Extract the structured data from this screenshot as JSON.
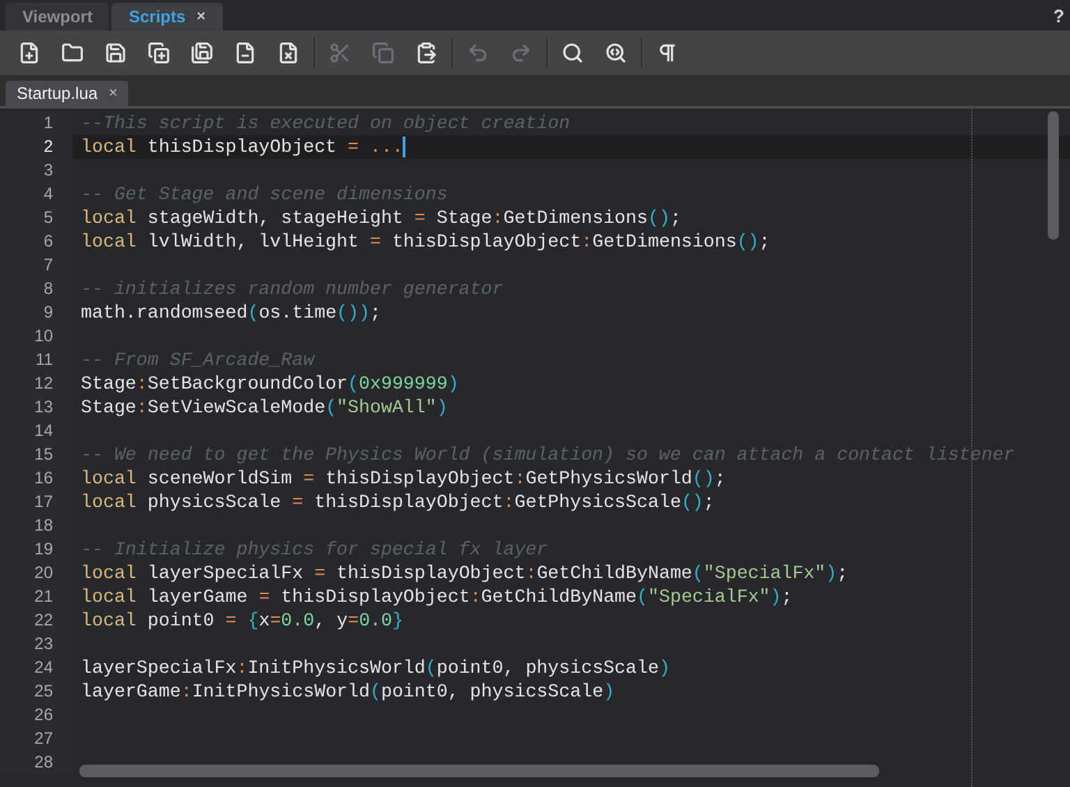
{
  "panel_tabs": [
    {
      "label": "Viewport",
      "selected": false
    },
    {
      "label": "Scripts",
      "selected": true,
      "close": "×"
    }
  ],
  "help": "?",
  "toolbar": [
    [
      {
        "kind": "new-file",
        "disabled": false
      },
      {
        "kind": "open",
        "disabled": false
      },
      {
        "kind": "save",
        "disabled": false
      },
      {
        "kind": "save-new",
        "disabled": false
      },
      {
        "kind": "save-all",
        "disabled": false
      },
      {
        "kind": "close-file",
        "disabled": false
      },
      {
        "kind": "close-all",
        "disabled": false
      }
    ],
    [
      {
        "kind": "cut",
        "disabled": true
      },
      {
        "kind": "copy",
        "disabled": true
      },
      {
        "kind": "paste",
        "disabled": false
      }
    ],
    [
      {
        "kind": "undo",
        "disabled": true
      },
      {
        "kind": "redo",
        "disabled": true
      }
    ],
    [
      {
        "kind": "find",
        "disabled": false
      },
      {
        "kind": "replace",
        "disabled": false
      }
    ],
    [
      {
        "kind": "whitespace",
        "disabled": false
      }
    ]
  ],
  "document_tabs": [
    {
      "label": "Startup.lua",
      "selected": true,
      "close": "×"
    }
  ],
  "lines": [
    {
      "number": "1",
      "current": false,
      "tokens": [
        {
          "kind": "comment",
          "text": "--This script is executed on object creation"
        }
      ]
    },
    {
      "number": "2",
      "current": true,
      "tokens": [
        {
          "kind": "keyword",
          "text": "local"
        },
        {
          "kind": "plain",
          "text": " thisDisplayObject "
        },
        {
          "kind": "op",
          "text": "= ..."
        }
      ]
    },
    {
      "number": "3",
      "current": false
    },
    {
      "number": "4",
      "current": false,
      "tokens": [
        {
          "kind": "comment",
          "text": "-- Get Stage and scene dimensions"
        }
      ]
    },
    {
      "number": "5",
      "current": false,
      "tokens": [
        {
          "kind": "keyword",
          "text": "local"
        },
        {
          "kind": "plain",
          "text": " stageWidth, stageHeight "
        },
        {
          "kind": "op",
          "text": "="
        },
        {
          "kind": "plain",
          "text": " Stage"
        },
        {
          "kind": "op",
          "text": ":"
        },
        {
          "kind": "plain",
          "text": "GetDimensions"
        },
        {
          "kind": "paren",
          "text": "()"
        },
        {
          "kind": "plain",
          "text": ";"
        }
      ]
    },
    {
      "number": "6",
      "current": false,
      "tokens": [
        {
          "kind": "keyword",
          "text": "local"
        },
        {
          "kind": "plain",
          "text": " lvlWidth, lvlHeight "
        },
        {
          "kind": "op",
          "text": "="
        },
        {
          "kind": "plain",
          "text": " thisDisplayObject"
        },
        {
          "kind": "op",
          "text": ":"
        },
        {
          "kind": "plain",
          "text": "GetDimensions"
        },
        {
          "kind": "paren",
          "text": "()"
        },
        {
          "kind": "plain",
          "text": ";"
        }
      ]
    },
    {
      "number": "7",
      "current": false
    },
    {
      "number": "8",
      "current": false,
      "tokens": [
        {
          "kind": "comment",
          "text": "-- initializes random number generator"
        }
      ]
    },
    {
      "number": "9",
      "current": false,
      "tokens": [
        {
          "kind": "plain",
          "text": "math.randomseed"
        },
        {
          "kind": "paren",
          "text": "("
        },
        {
          "kind": "plain",
          "text": "os.time"
        },
        {
          "kind": "paren",
          "text": "())"
        },
        {
          "kind": "plain",
          "text": ";"
        }
      ]
    },
    {
      "number": "10",
      "current": false
    },
    {
      "number": "11",
      "current": false,
      "tokens": [
        {
          "kind": "comment",
          "text": "-- From SF_Arcade_Raw"
        }
      ]
    },
    {
      "number": "12",
      "current": false,
      "tokens": [
        {
          "kind": "plain",
          "text": "Stage"
        },
        {
          "kind": "op",
          "text": ":"
        },
        {
          "kind": "plain",
          "text": "SetBackgroundColor"
        },
        {
          "kind": "paren",
          "text": "("
        },
        {
          "kind": "number",
          "text": "0x999999"
        },
        {
          "kind": "paren",
          "text": ")"
        }
      ]
    },
    {
      "number": "13",
      "current": false,
      "tokens": [
        {
          "kind": "plain",
          "text": "Stage"
        },
        {
          "kind": "op",
          "text": ":"
        },
        {
          "kind": "plain",
          "text": "SetViewScaleMode"
        },
        {
          "kind": "paren",
          "text": "("
        },
        {
          "kind": "string",
          "text": "\"ShowAll\""
        },
        {
          "kind": "paren",
          "text": ")"
        }
      ]
    },
    {
      "number": "14",
      "current": false
    },
    {
      "number": "15",
      "current": false,
      "tokens": [
        {
          "kind": "comment",
          "text": "-- We need to get the Physics World (simulation) so we can attach a contact listener"
        }
      ]
    },
    {
      "number": "16",
      "current": false,
      "tokens": [
        {
          "kind": "keyword",
          "text": "local"
        },
        {
          "kind": "plain",
          "text": " sceneWorldSim "
        },
        {
          "kind": "op",
          "text": "="
        },
        {
          "kind": "plain",
          "text": " thisDisplayObject"
        },
        {
          "kind": "op",
          "text": ":"
        },
        {
          "kind": "plain",
          "text": "GetPhysicsWorld"
        },
        {
          "kind": "paren",
          "text": "()"
        },
        {
          "kind": "plain",
          "text": ";"
        }
      ]
    },
    {
      "number": "17",
      "current": false,
      "tokens": [
        {
          "kind": "keyword",
          "text": "local"
        },
        {
          "kind": "plain",
          "text": " physicsScale "
        },
        {
          "kind": "op",
          "text": "="
        },
        {
          "kind": "plain",
          "text": " thisDisplayObject"
        },
        {
          "kind": "op",
          "text": ":"
        },
        {
          "kind": "plain",
          "text": "GetPhysicsScale"
        },
        {
          "kind": "paren",
          "text": "()"
        },
        {
          "kind": "plain",
          "text": ";"
        }
      ]
    },
    {
      "number": "18",
      "current": false
    },
    {
      "number": "19",
      "current": false,
      "tokens": [
        {
          "kind": "comment",
          "text": "-- Initialize physics for special fx layer"
        }
      ]
    },
    {
      "number": "20",
      "current": false,
      "tokens": [
        {
          "kind": "keyword",
          "text": "local"
        },
        {
          "kind": "plain",
          "text": " layerSpecialFx "
        },
        {
          "kind": "op",
          "text": "="
        },
        {
          "kind": "plain",
          "text": " thisDisplayObject"
        },
        {
          "kind": "op",
          "text": ":"
        },
        {
          "kind": "plain",
          "text": "GetChildByName"
        },
        {
          "kind": "paren",
          "text": "("
        },
        {
          "kind": "string",
          "text": "\"SpecialFx\""
        },
        {
          "kind": "paren",
          "text": ")"
        },
        {
          "kind": "plain",
          "text": ";"
        }
      ]
    },
    {
      "number": "21",
      "current": false,
      "tokens": [
        {
          "kind": "keyword",
          "text": "local"
        },
        {
          "kind": "plain",
          "text": " layerGame "
        },
        {
          "kind": "op",
          "text": "="
        },
        {
          "kind": "plain",
          "text": " thisDisplayObject"
        },
        {
          "kind": "op",
          "text": ":"
        },
        {
          "kind": "plain",
          "text": "GetChildByName"
        },
        {
          "kind": "paren",
          "text": "("
        },
        {
          "kind": "string",
          "text": "\"SpecialFx\""
        },
        {
          "kind": "paren",
          "text": ")"
        },
        {
          "kind": "plain",
          "text": ";"
        }
      ]
    },
    {
      "number": "22",
      "current": false,
      "tokens": [
        {
          "kind": "keyword",
          "text": "local"
        },
        {
          "kind": "plain",
          "text": " point0 "
        },
        {
          "kind": "op",
          "text": "="
        },
        {
          "kind": "paren",
          "text": " {"
        },
        {
          "kind": "plain",
          "text": "x"
        },
        {
          "kind": "op",
          "text": "="
        },
        {
          "kind": "number",
          "text": "0.0"
        },
        {
          "kind": "plain",
          "text": ", y"
        },
        {
          "kind": "op",
          "text": "="
        },
        {
          "kind": "number",
          "text": "0.0"
        },
        {
          "kind": "paren",
          "text": "}"
        }
      ]
    },
    {
      "number": "23",
      "current": false
    },
    {
      "number": "24",
      "current": false,
      "tokens": [
        {
          "kind": "plain",
          "text": "layerSpecialFx"
        },
        {
          "kind": "op",
          "text": ":"
        },
        {
          "kind": "plain",
          "text": "InitPhysicsWorld"
        },
        {
          "kind": "paren",
          "text": "("
        },
        {
          "kind": "plain",
          "text": "point0, physicsScale"
        },
        {
          "kind": "paren",
          "text": ")"
        }
      ]
    },
    {
      "number": "25",
      "current": false,
      "tokens": [
        {
          "kind": "plain",
          "text": "layerGame"
        },
        {
          "kind": "op",
          "text": ":"
        },
        {
          "kind": "plain",
          "text": "InitPhysicsWorld"
        },
        {
          "kind": "paren",
          "text": "("
        },
        {
          "kind": "plain",
          "text": "point0, physicsScale"
        },
        {
          "kind": "paren",
          "text": ")"
        }
      ]
    },
    {
      "number": "26",
      "current": false
    },
    {
      "number": "27",
      "current": false
    },
    {
      "number": "28",
      "current": false
    }
  ]
}
